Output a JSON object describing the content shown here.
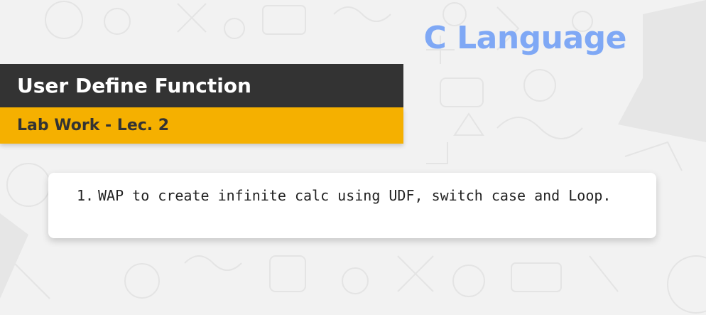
{
  "header": {
    "course_title": "C Language"
  },
  "topic": {
    "title": "User Define Function",
    "subtitle": "Lab Work - Lec. 2"
  },
  "tasks": [
    {
      "number": "1.",
      "text": "WAP to create infinite calc using UDF, switch case and Loop."
    }
  ],
  "colors": {
    "background": "#f2f2f2",
    "course_title": "#7fa8f5",
    "topic_bar": "#333333",
    "subtitle_bar": "#f5b000",
    "card": "#ffffff"
  },
  "decorations": {
    "background_pattern": "school-doodles"
  }
}
